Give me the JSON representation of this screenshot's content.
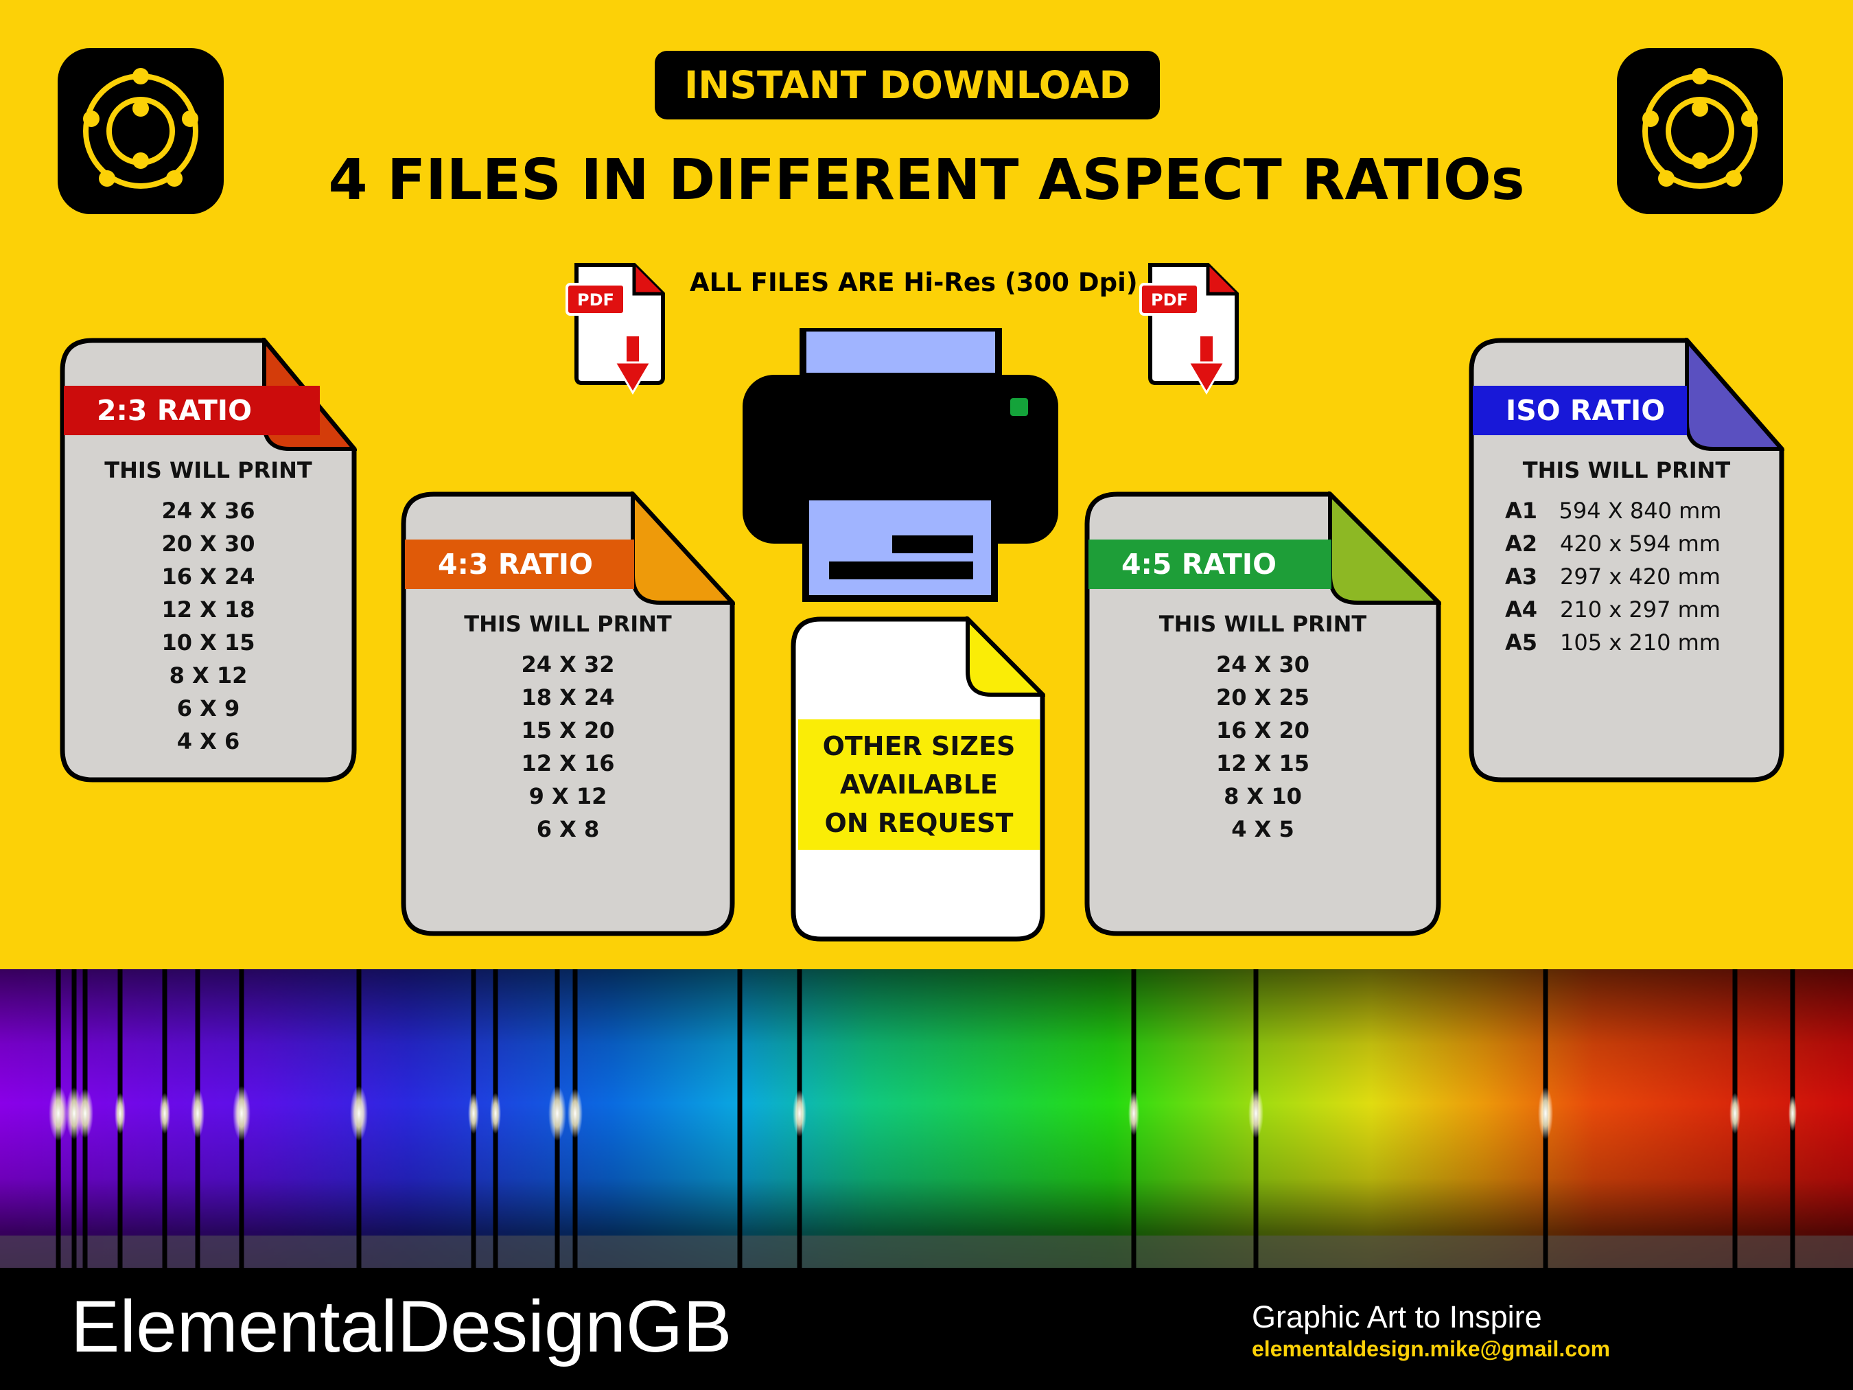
{
  "header": {
    "badge": "INSTANT DOWNLOAD",
    "headline": "4 FILES IN DIFFERENT ASPECT RATIOs",
    "hires_note": "ALL FILES ARE Hi-Res (300 Dpi)",
    "pdf_label": "PDF"
  },
  "cards": {
    "r23": {
      "title": "2:3 RATIO",
      "caption": "THIS WILL PRINT",
      "sizes": [
        "24 X 36",
        "20 X 30",
        "16 X 24",
        "12 X 18",
        "10 X 15",
        "8 X 12",
        "6 X 9",
        "4 X 6"
      ]
    },
    "r43": {
      "title": "4:3 RATIO",
      "caption": "THIS WILL PRINT",
      "sizes": [
        "24 X 32",
        "18 X 24",
        "15 X 20",
        "12 X 16",
        "9 X 12",
        "6 X 8"
      ]
    },
    "r45": {
      "title": "4:5 RATIO",
      "caption": "THIS WILL PRINT",
      "sizes": [
        "24 X 30",
        "20 X 25",
        "16 X 20",
        "12 X 15",
        "8 X 10",
        "4 X 5"
      ]
    },
    "iso": {
      "title": "ISO RATIO",
      "caption": "THIS WILL PRINT",
      "sizes": [
        {
          "name": "A1",
          "dims": "594 X 840 mm"
        },
        {
          "name": "A2",
          "dims": "420 x 594 mm"
        },
        {
          "name": "A3",
          "dims": "297 x 420 mm"
        },
        {
          "name": "A4",
          "dims": "210 x 297 mm"
        },
        {
          "name": "A5",
          "dims": "105 x 210 mm"
        }
      ]
    }
  },
  "other_sizes": [
    "OTHER SIZES",
    "AVAILABLE",
    "ON REQUEST"
  ],
  "footer": {
    "brand": "ElementalDesignGB",
    "tagline": "Graphic Art to Inspire",
    "email": "elementaldesign.mike@gmail.com"
  },
  "colors": {
    "background": "#fcd107",
    "card_fill": "#d4d2cf",
    "band_23": "#cc0c0c",
    "fold_23": "#d43c0a",
    "band_43": "#e05a08",
    "fold_43": "#ee9a0a",
    "band_45": "#1e9e38",
    "fold_45": "#8db824",
    "band_iso": "#1818d8",
    "fold_iso": "#5a50c0",
    "other_band": "#faed06",
    "pdf_tag": "#e01010",
    "printer_paper": "#a0b4ff"
  }
}
